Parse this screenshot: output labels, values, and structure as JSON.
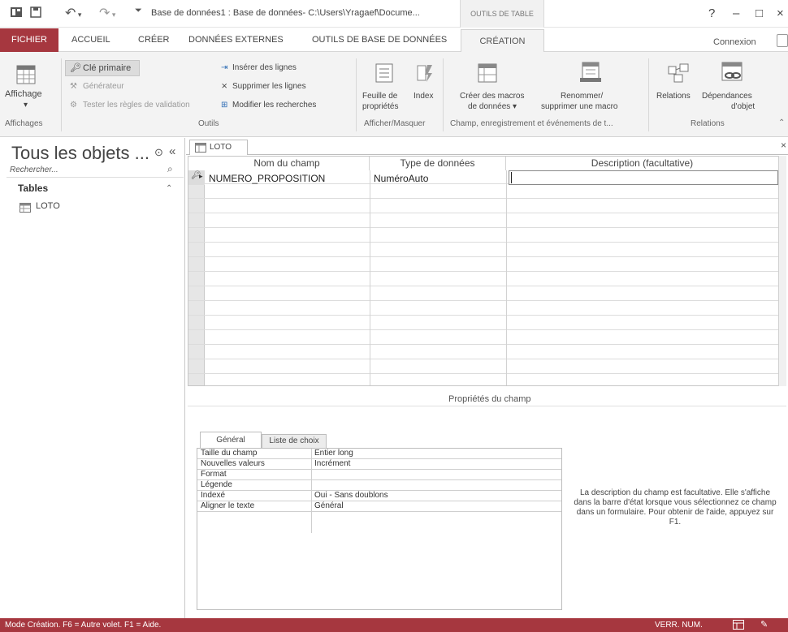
{
  "titlebar": {
    "title": "Base de données1 : Base de données- C:\\Users\\Yragaef\\Docume...",
    "context_group": "OUTILS DE TABLE",
    "help": "?",
    "minimize": "–",
    "restore": "□",
    "close": "×"
  },
  "tabs": {
    "fichier": "FICHIER",
    "accueil": "ACCUEIL",
    "creer": "CRÉER",
    "donnees_externes": "DONNÉES EXTERNES",
    "outils_bdd": "OUTILS DE BASE DE DONNÉES",
    "creation": "CRÉATION",
    "connexion": "Connexion"
  },
  "ribbon": {
    "affichage": "Affichage",
    "cle_primaire": "Clé primaire",
    "generateur": "Générateur",
    "tester": "Tester les règles de validation",
    "inserer": "Insérer des lignes",
    "supprimer": "Supprimer les lignes",
    "modifier": "Modifier les recherches",
    "feuille_1": "Feuille de",
    "feuille_2": "propriétés",
    "index": "Index",
    "creer_macros_1": "Créer des macros",
    "creer_macros_2": "de données ▾",
    "renommer_1": "Renommer/",
    "renommer_2": "supprimer une macro",
    "relations": "Relations",
    "dependances_1": "Dépendances",
    "dependances_2": "d'objet",
    "groups": {
      "affichages": "Affichages",
      "outils": "Outils",
      "afficher": "Afficher/Masquer",
      "champ": "Champ, enregistrement et événements de t...",
      "relations": "Relations"
    }
  },
  "nav": {
    "title": "Tous les objets ...",
    "search_placeholder": "Rechercher...",
    "section": "Tables",
    "item": "LOTO"
  },
  "document": {
    "tab": "LOTO",
    "columns": [
      "Nom du champ",
      "Type de données",
      "Description (facultative)"
    ],
    "field_name": "NUMERO_PROPOSITION",
    "field_type": "NuméroAuto",
    "props_title": "Propriétés du champ",
    "ptab_general": "Général",
    "ptab_liste": "Liste de choix",
    "properties": [
      {
        "label": "Taille du champ",
        "value": "Entier long"
      },
      {
        "label": "Nouvelles valeurs",
        "value": "Incrément"
      },
      {
        "label": "Format",
        "value": ""
      },
      {
        "label": "Légende",
        "value": ""
      },
      {
        "label": "Indexé",
        "value": "Oui - Sans doublons"
      },
      {
        "label": "Aligner le texte",
        "value": "Général"
      }
    ],
    "help": "La description du champ est facultative. Elle s'affiche dans la barre d'état lorsque vous sélectionnez ce champ dans un formulaire. Pour obtenir de l'aide, appuyez sur F1."
  },
  "status": {
    "left": "Mode Création. F6 = Autre volet. F1 = Aide.",
    "right": "VERR. NUM."
  }
}
